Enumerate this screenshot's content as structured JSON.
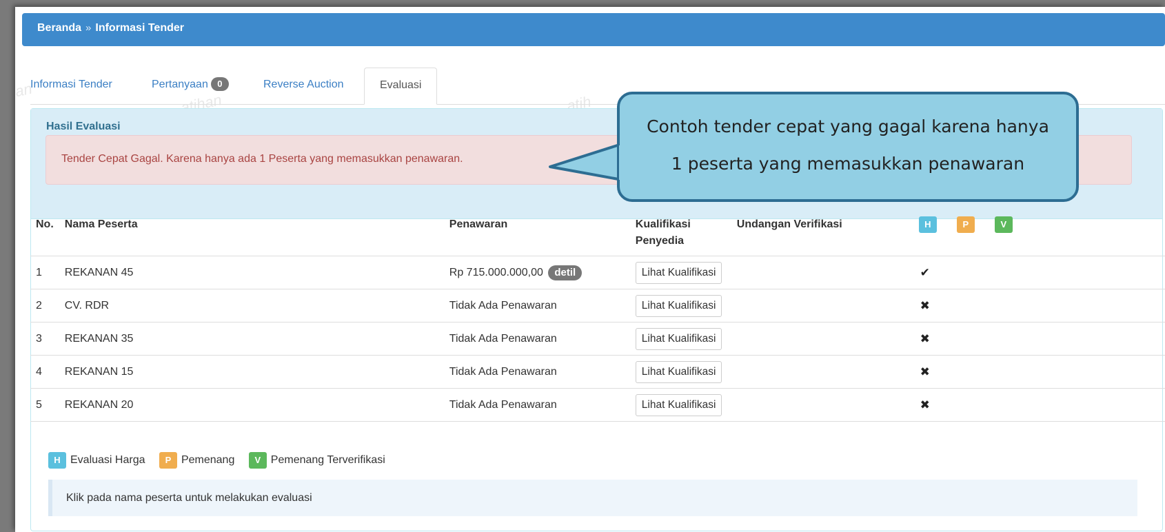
{
  "breadcrumb": {
    "home": "Beranda",
    "separator": "»",
    "current": "Informasi Tender"
  },
  "tabs": [
    {
      "label": "Informasi Tender"
    },
    {
      "label": "Pertanyaan",
      "badge": "0"
    },
    {
      "label": "Reverse Auction"
    },
    {
      "label": "Evaluasi",
      "active": true
    }
  ],
  "panel": {
    "title": "Hasil Evaluasi",
    "alert": "Tender Cepat Gagal. Karena hanya ada 1 Peserta yang memasukkan penawaran."
  },
  "table": {
    "headers": {
      "no": "No.",
      "nama": "Nama Peserta",
      "penawaran": "Penawaran",
      "kualifikasi_line1": "Kualifikasi",
      "kualifikasi_line2": "Penyedia",
      "undangan": "Undangan Verifikasi",
      "h": "H",
      "p": "P",
      "v": "V"
    },
    "rows": [
      {
        "no": "1",
        "nama": "REKANAN 45",
        "penawaran": "Rp 715.000.000,00",
        "detil": "detil",
        "button": "Lihat Kualifikasi",
        "h": "✔"
      },
      {
        "no": "2",
        "nama": "CV. RDR",
        "penawaran": "Tidak Ada Penawaran",
        "button": "Lihat Kualifikasi",
        "h": "✖"
      },
      {
        "no": "3",
        "nama": "REKANAN 35",
        "penawaran": "Tidak Ada Penawaran",
        "button": "Lihat Kualifikasi",
        "h": "✖"
      },
      {
        "no": "4",
        "nama": "REKANAN 15",
        "penawaran": "Tidak Ada Penawaran",
        "button": "Lihat Kualifikasi",
        "h": "✖"
      },
      {
        "no": "5",
        "nama": "REKANAN 20",
        "penawaran": "Tidak Ada Penawaran",
        "button": "Lihat Kualifikasi",
        "h": "✖"
      }
    ]
  },
  "legend": [
    {
      "key": "H",
      "label": "Evaluasi Harga"
    },
    {
      "key": "P",
      "label": "Pemenang"
    },
    {
      "key": "V",
      "label": "Pemenang Terverifikasi"
    }
  ],
  "note": "Klik pada nama peserta untuk melakukan evaluasi",
  "callout": {
    "line1": "Contoh tender cepat yang gagal karena hanya",
    "line2": "1 peserta yang memasukkan penawaran"
  },
  "colors": {
    "breadcrumb_bg": "#3e8acc",
    "label_h": "#5bc0de",
    "label_p": "#f0ad4e",
    "label_v": "#5cb85c",
    "alert_text": "#a94442",
    "callout_bg": "#92cfe4"
  }
}
